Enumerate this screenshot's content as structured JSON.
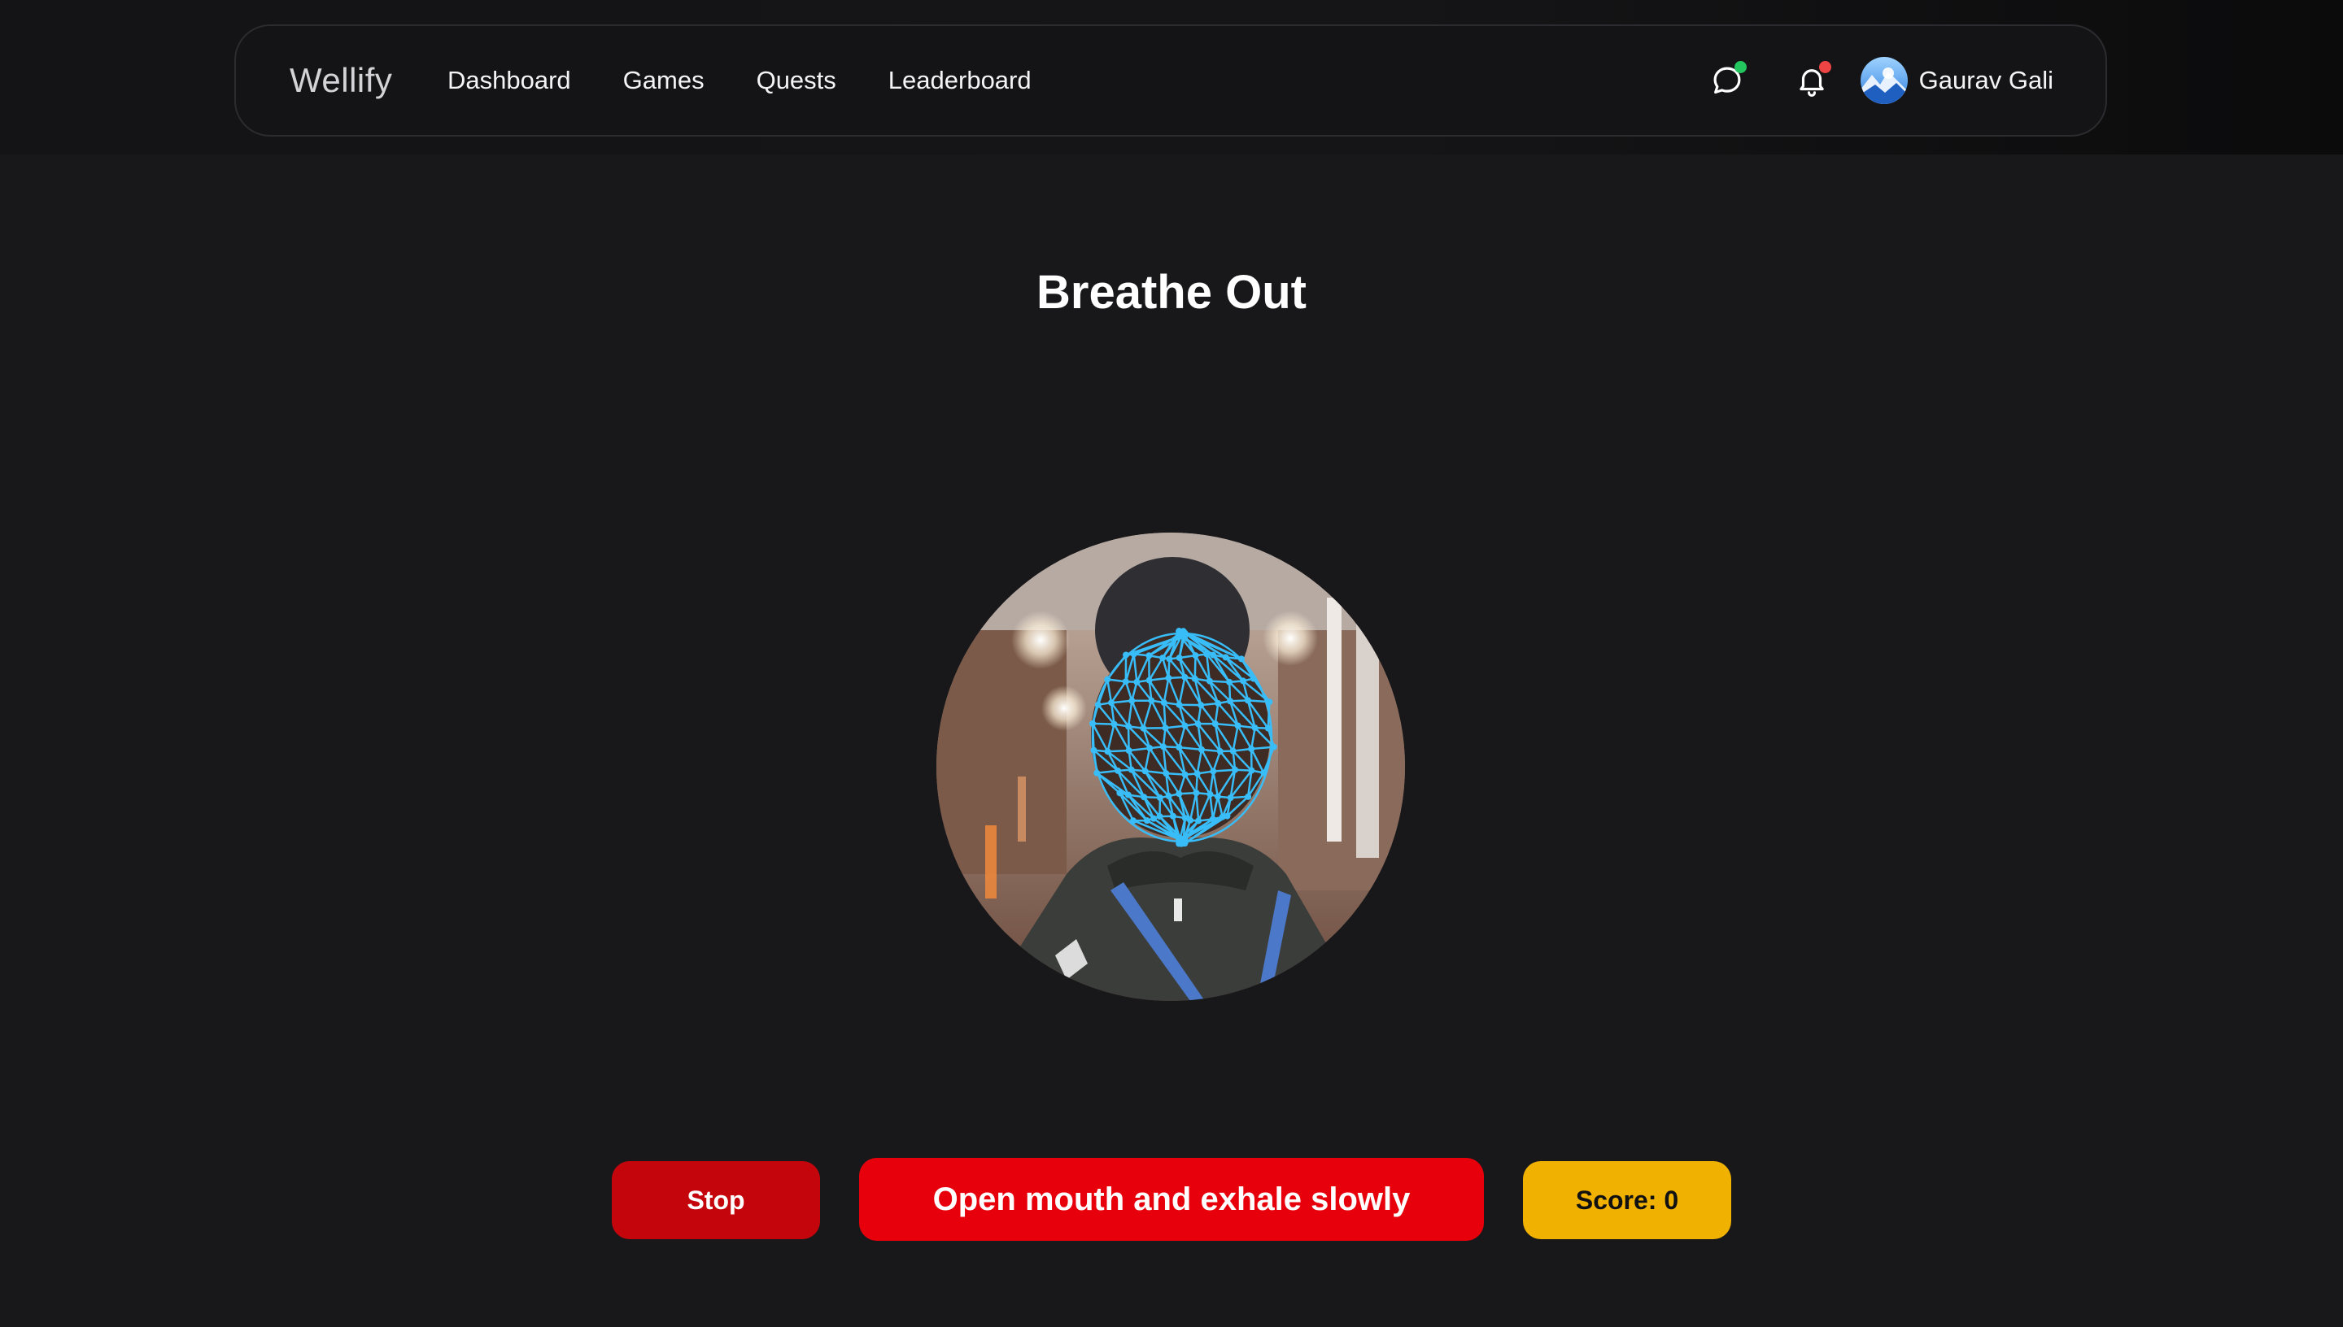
{
  "app": {
    "brand": "Wellify"
  },
  "nav": {
    "links": [
      {
        "label": "Dashboard",
        "icon": ""
      },
      {
        "label": "Games",
        "icon": ""
      },
      {
        "label": "Quests",
        "icon": ""
      },
      {
        "label": "Leaderboard",
        "icon": ""
      }
    ],
    "chat_icon": "chat-bubble-icon",
    "chat_indicator_color": "#22c55e",
    "notification_icon": "bell-icon",
    "notification_indicator_color": "#ef4444",
    "user": {
      "name": "Gaurav Gali",
      "avatar": "avatar-image"
    }
  },
  "game": {
    "title": "Breathe Out",
    "camera_feed": "webcam-feed-with-face-mesh-overlay",
    "mesh_color": "#38bdf8",
    "stop_label": "Stop",
    "instruction": "Open mouth and exhale slowly",
    "score_label": "Score: 0"
  },
  "colors": {
    "background": "#18181b",
    "stop": "#c5050c",
    "instruction": "#e7000b",
    "score": "#f0b100"
  }
}
